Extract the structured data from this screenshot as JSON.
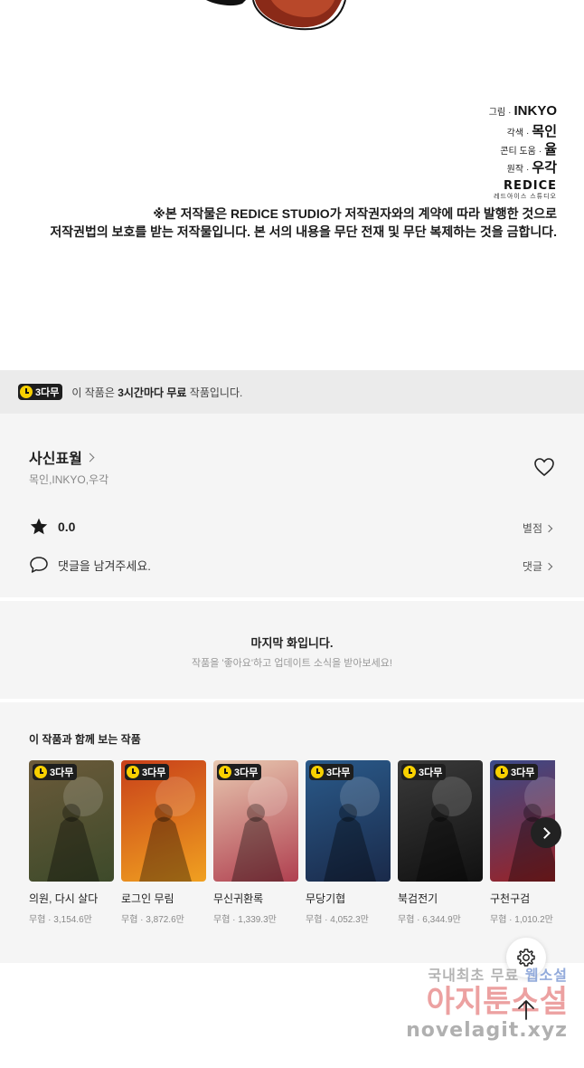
{
  "comic": {
    "credits": [
      {
        "role": "그림",
        "name": "INKYO"
      },
      {
        "role": "각색",
        "name": "목인"
      },
      {
        "role": "콘티 도움",
        "name": "율"
      },
      {
        "role": "원작",
        "name": "우각"
      }
    ],
    "studio_logo": "REDICE",
    "studio_sub": "레드아이스 스튜디오",
    "copyright_line1": "※본 저작물은 REDICE STUDIO가 저작권자와의 계약에 따라 발행한 것으로",
    "copyright_line2": "저작권법의 보호를 받는 저작물입니다. 본 서의 내용을 무단 전재 및 무단 복제하는 것을 금합니다."
  },
  "banner": {
    "badge": "3다무",
    "text_prefix": "이 작품은 ",
    "text_bold": "3시간마다 무료",
    "text_suffix": " 작품입니다."
  },
  "work": {
    "title": "사신표월",
    "authors": "목인,INKYO,우각",
    "rating": "0.0",
    "rating_link": "별점",
    "comment_placeholder": "댓글을 남겨주세요.",
    "comment_link": "댓글"
  },
  "last_chapter": {
    "title": "마지막 화입니다.",
    "subtitle": "작품을 '좋아요'하고 업데이트 소식을 받아보세요!"
  },
  "recommendations": {
    "heading": "이 작품과 함께 보는 작품",
    "items": [
      {
        "badge": "3다무",
        "title": "의원, 다시 살다",
        "meta": "무협 · 3,154.6만",
        "c1": "#6b5a3a",
        "c2": "#3d4a2a"
      },
      {
        "badge": "3다무",
        "title": "로그인 무림",
        "meta": "무협 · 3,872.6만",
        "c1": "#c8401a",
        "c2": "#f0a020"
      },
      {
        "badge": "3다무",
        "title": "무신귀환록",
        "meta": "무협 · 1,339.3만",
        "c1": "#e8c8b0",
        "c2": "#b04050"
      },
      {
        "badge": "3다무",
        "title": "무당기협",
        "meta": "무협 · 4,052.3만",
        "c1": "#2a5a8a",
        "c2": "#1a2a4a"
      },
      {
        "badge": "3다무",
        "title": "북검전기",
        "meta": "무협 · 6,344.9만",
        "c1": "#3a3a3a",
        "c2": "#111111"
      },
      {
        "badge": "3다무",
        "title": "구천구검",
        "meta": "무협 · 1,010.2만",
        "c1": "#3a4a8a",
        "c2": "#a02020"
      }
    ]
  },
  "watermark": {
    "line1a": "국내최초 무료 ",
    "line1b": "웹소설",
    "line2": "아지툰소설",
    "line3": "novelagit.xyz"
  }
}
